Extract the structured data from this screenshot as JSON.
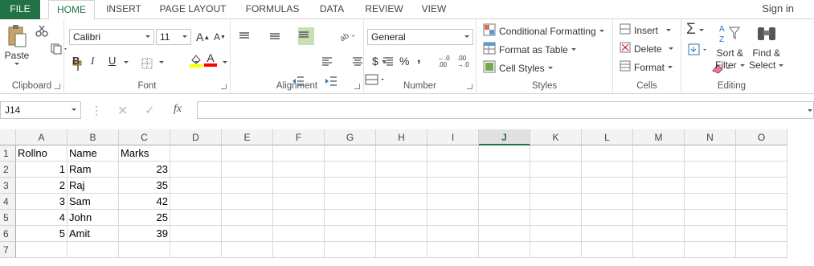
{
  "tabs": {
    "file": "FILE",
    "home": "HOME",
    "insert": "INSERT",
    "page_layout": "PAGE LAYOUT",
    "formulas": "FORMULAS",
    "data": "DATA",
    "review": "REVIEW",
    "view": "VIEW"
  },
  "signin": "Sign in",
  "ribbon": {
    "clipboard": {
      "paste": "Paste",
      "label": "Clipboard"
    },
    "font": {
      "name": "Calibri",
      "size": "11",
      "bold": "B",
      "italic": "I",
      "underline": "U",
      "grow": "A",
      "shrink": "A",
      "color_a": "A",
      "label": "Font"
    },
    "alignment": {
      "label": "Alignment"
    },
    "number": {
      "format": "General",
      "currency": "$",
      "percent": "%",
      "comma": ",",
      "inc_decimal": "←.0 .00",
      "dec_decimal": ".00 →.0",
      "label": "Number"
    },
    "styles": {
      "conditional": "Conditional Formatting",
      "table": "Format as Table",
      "cell_styles": "Cell Styles",
      "label": "Styles"
    },
    "cells": {
      "insert": "Insert",
      "delete": "Delete",
      "format": "Format",
      "label": "Cells"
    },
    "editing": {
      "sort": "Sort &",
      "filter": "Filter",
      "find": "Find &",
      "select": "Select",
      "label": "Editing"
    }
  },
  "formula_bar": {
    "name_box": "J14",
    "fx": "fx",
    "content": ""
  },
  "grid": {
    "columns": [
      "A",
      "B",
      "C",
      "D",
      "E",
      "F",
      "G",
      "H",
      "I",
      "J",
      "K",
      "L",
      "M",
      "N",
      "O"
    ],
    "selected_column": "J",
    "rows": [
      "1",
      "2",
      "3",
      "4",
      "5",
      "6",
      "7"
    ],
    "cells": [
      [
        "Rollno",
        "Name",
        "Marks"
      ],
      [
        "1",
        "Ram",
        "23"
      ],
      [
        "2",
        "Raj",
        "35"
      ],
      [
        "3",
        "Sam",
        "42"
      ],
      [
        "4",
        "John",
        "25"
      ],
      [
        "5",
        "Amit",
        "39"
      ]
    ]
  },
  "colors": {
    "accent": "#217346",
    "font_color_bar": "#ff0000",
    "highlight_bar": "#ffff00"
  }
}
